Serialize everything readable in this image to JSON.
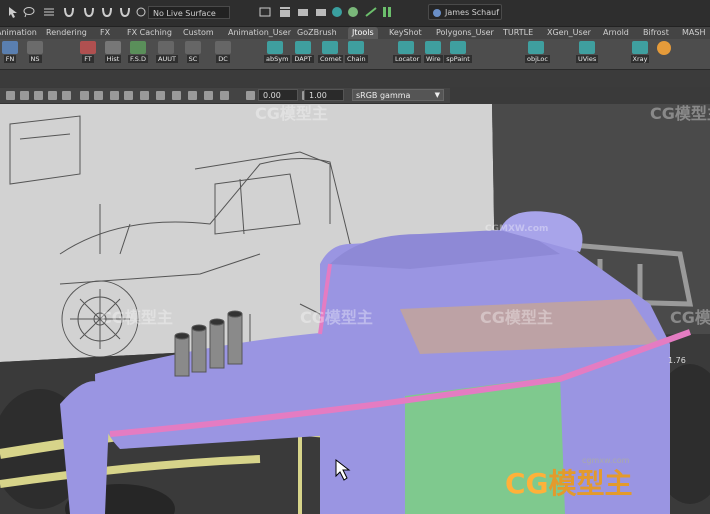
{
  "toolbar": {
    "live_surface": "No Live Surface",
    "user": "James Schauf"
  },
  "shelf_tabs": [
    {
      "label": "Animation"
    },
    {
      "label": "Rendering"
    },
    {
      "label": "FX"
    },
    {
      "label": "FX Caching"
    },
    {
      "label": "Custom"
    },
    {
      "label": "Animation_User"
    },
    {
      "label": "GoZBrush"
    },
    {
      "label": "Jtools"
    },
    {
      "label": "KeyShot"
    },
    {
      "label": "Polygons_User"
    },
    {
      "label": "TURTLE"
    },
    {
      "label": "XGen_User"
    },
    {
      "label": "Arnold"
    },
    {
      "label": "Bifrost"
    },
    {
      "label": "MASH"
    }
  ],
  "shelf_buttons": [
    {
      "label": "FN",
      "color": "#5a7fb0"
    },
    {
      "label": "NS",
      "color": "#6b6b6b"
    },
    {
      "label": "FT",
      "color": "#b05050"
    },
    {
      "label": "Hist",
      "color": "#777"
    },
    {
      "label": "F.S.D",
      "color": "#5a8f5a"
    },
    {
      "label": "AUUT",
      "color": "#666"
    },
    {
      "label": "SC",
      "color": "#666"
    },
    {
      "label": "DC",
      "color": "#666"
    },
    {
      "label": "abSym",
      "color": "#3f9f9f"
    },
    {
      "label": "DAPT",
      "color": "#3f9f9f"
    },
    {
      "label": "Comet",
      "color": "#3f9f9f"
    },
    {
      "label": "Chain",
      "color": "#3f9f9f"
    },
    {
      "label": "Locator",
      "color": "#3f9f9f"
    },
    {
      "label": "Wire",
      "color": "#3f9f9f"
    },
    {
      "label": "spPaint",
      "color": "#3f9f9f"
    },
    {
      "label": "objLoc",
      "color": "#3f9f9f"
    },
    {
      "label": "UVies",
      "color": "#3f9f9f"
    },
    {
      "label": "Xray",
      "color": "#3f9f9f"
    }
  ],
  "panel": {
    "exposure": "0.00",
    "gamma": "1.00",
    "color_space": "sRGB gamma"
  },
  "viewport": {
    "coord_label": "1.76",
    "watermarks": [
      "CG模型主",
      "CG模型主",
      "CG模型主",
      "CG模型主",
      "CG模型主",
      "CG模型主"
    ],
    "watermark_url": "CGMXW.com",
    "brand_url": "cgmxw.com",
    "brand_text": "模型主",
    "brand_prefix": "CG"
  },
  "colors": {
    "car_body": "#9a95e2",
    "pink_trim": "#e47cc2",
    "green_panel": "#7fc98e",
    "blueprint_bg": "#d6d6d6",
    "viewport_bg": "#3f3f3f"
  }
}
